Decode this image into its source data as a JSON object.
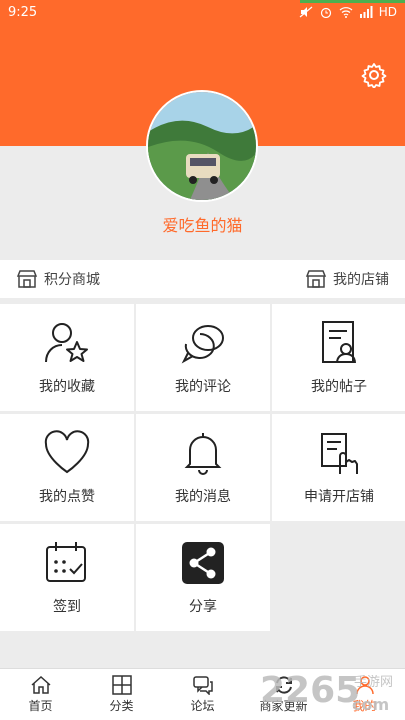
{
  "status_bar": {
    "time": "9:25",
    "network": "HD"
  },
  "profile": {
    "username": "爱吃鱼的猫"
  },
  "shop_bar": {
    "points_mall": "积分商城",
    "my_shop": "我的店铺"
  },
  "grid": [
    {
      "label": "我的收藏",
      "icon": "user-star-icon"
    },
    {
      "label": "我的评论",
      "icon": "chat-bubbles-icon"
    },
    {
      "label": "我的帖子",
      "icon": "document-user-icon"
    },
    {
      "label": "我的点赞",
      "icon": "heart-icon"
    },
    {
      "label": "我的消息",
      "icon": "bell-icon"
    },
    {
      "label": "申请开店铺",
      "icon": "hand-document-icon"
    },
    {
      "label": "签到",
      "icon": "calendar-check-icon"
    },
    {
      "label": "分享",
      "icon": "share-icon"
    }
  ],
  "tabbar": [
    {
      "label": "首页",
      "icon": "home-icon"
    },
    {
      "label": "分类",
      "icon": "category-icon"
    },
    {
      "label": "论坛",
      "icon": "forum-icon"
    },
    {
      "label": "商家更新",
      "icon": "refresh-icon"
    },
    {
      "label": "我的",
      "icon": "profile-icon",
      "active": true
    }
  ],
  "watermark": {
    "text": "2265",
    "suffix": "com",
    "site": "手游网"
  },
  "colors": {
    "accent": "#ff6a2b",
    "background": "#ececec"
  }
}
